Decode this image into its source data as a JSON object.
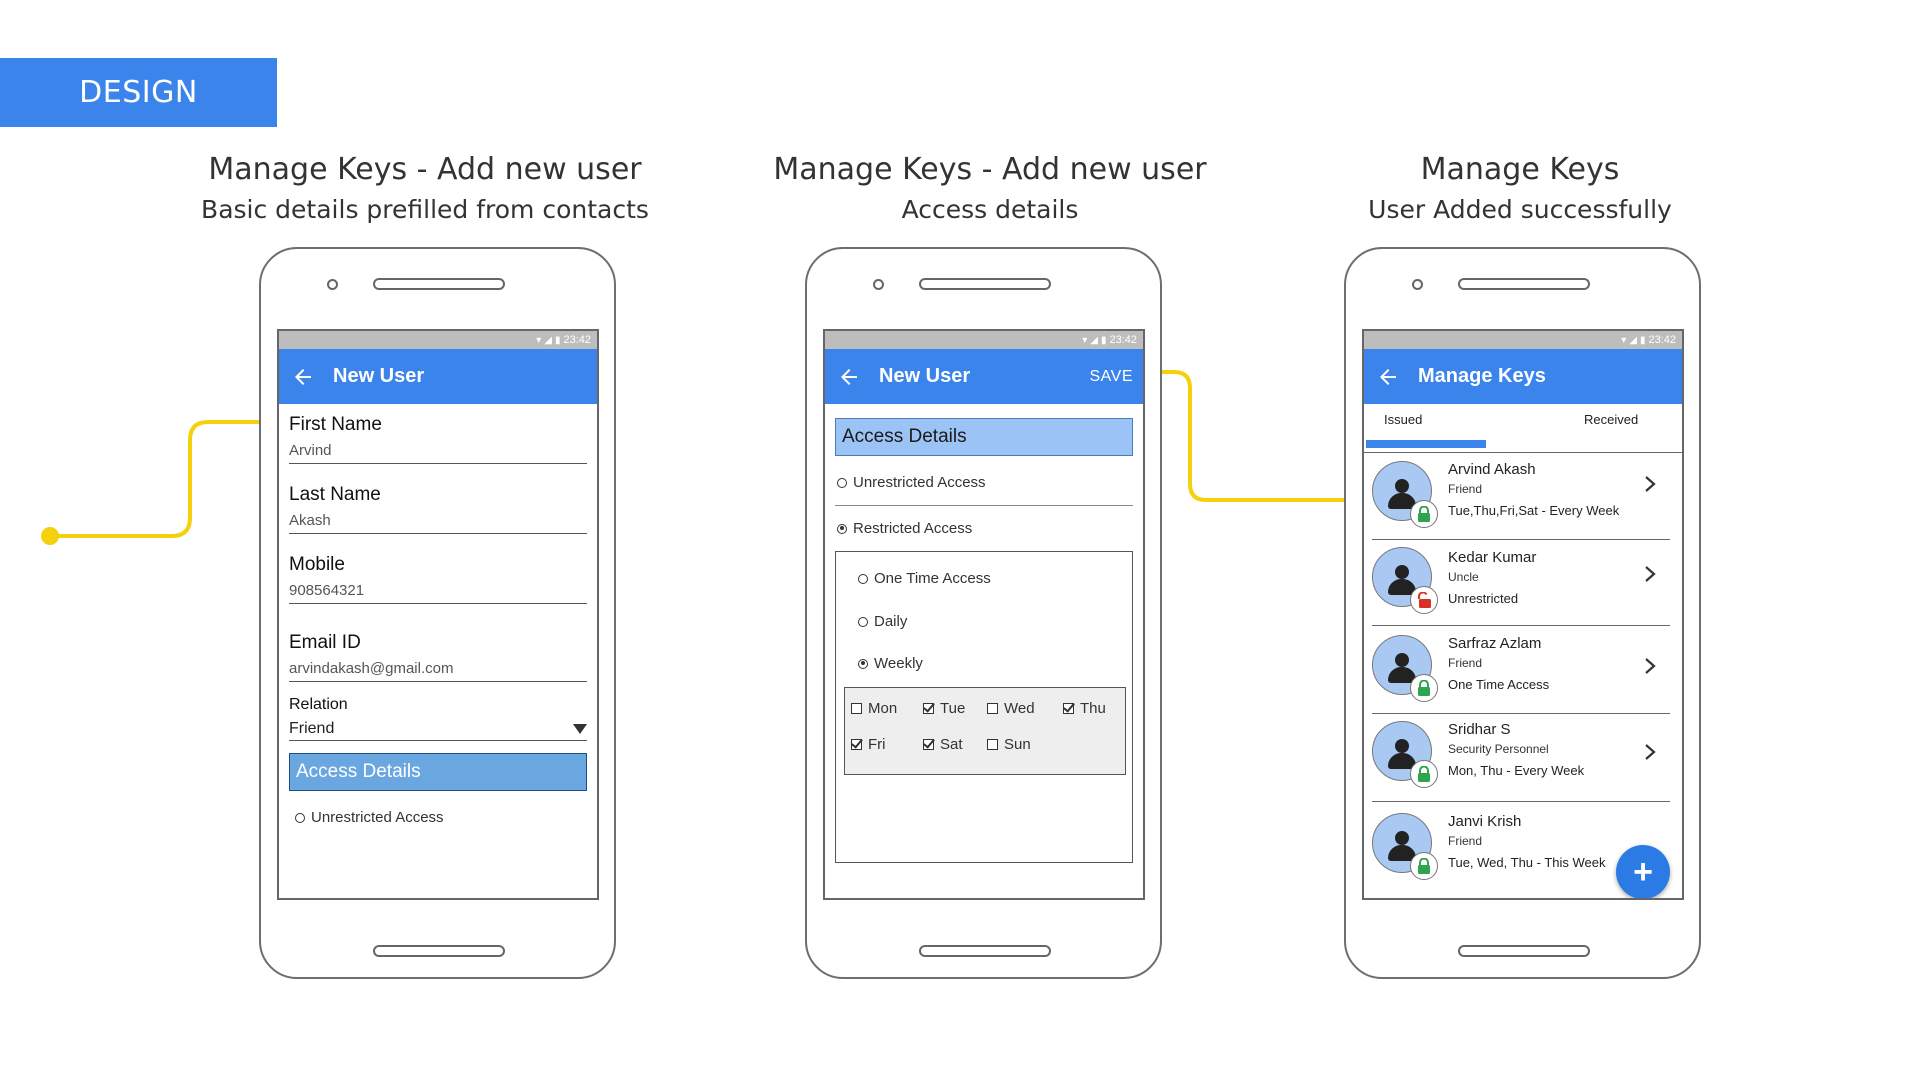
{
  "banner": {
    "label": "DESIGN"
  },
  "colors": {
    "accent": "#3b84ec",
    "connector": "#f5d10c",
    "lock_green": "#2ea44f",
    "lock_red": "#d93025"
  },
  "headings": [
    {
      "title": "Manage Keys - Add new user",
      "subtitle": "Basic details prefilled from contacts"
    },
    {
      "title": "Manage Keys - Add new user",
      "subtitle": "Access details"
    },
    {
      "title": "Manage Keys",
      "subtitle": "User Added successfully"
    }
  ],
  "status": {
    "time": "23:42"
  },
  "screen1": {
    "title": "New User",
    "fields": [
      {
        "label": "First Name",
        "value": "Arvind"
      },
      {
        "label": "Last Name",
        "value": "Akash"
      },
      {
        "label": "Mobile",
        "value": "908564321"
      },
      {
        "label": "Email ID",
        "value": "arvindakash@gmail.com"
      }
    ],
    "relation": {
      "label": "Relation",
      "value": "Friend"
    },
    "section": "Access Details",
    "option": "Unrestricted Access"
  },
  "screen2": {
    "title": "New User",
    "save": "SAVE",
    "section": "Access Details",
    "access_options": [
      "Unrestricted Access",
      "Restricted Access"
    ],
    "restricted_options": [
      "One Time Access",
      "Daily",
      "Weekly"
    ],
    "days": [
      {
        "label": "Mon",
        "checked": false
      },
      {
        "label": "Tue",
        "checked": true
      },
      {
        "label": "Wed",
        "checked": false
      },
      {
        "label": "Thu",
        "checked": true
      },
      {
        "label": "Fri",
        "checked": true
      },
      {
        "label": "Sat",
        "checked": true
      },
      {
        "label": "Sun",
        "checked": false
      }
    ]
  },
  "screen3": {
    "title": "Manage Keys",
    "tabs": [
      "Issued",
      "Received"
    ],
    "users": [
      {
        "name": "Arvind Akash",
        "relation": "Friend",
        "schedule": "Tue,Thu,Fri,Sat - Every Week",
        "lock": "locked"
      },
      {
        "name": "Kedar Kumar",
        "relation": "Uncle",
        "schedule": "Unrestricted",
        "lock": "unlocked"
      },
      {
        "name": "Sarfraz Azlam",
        "relation": "Friend",
        "schedule": "One Time Access",
        "lock": "locked"
      },
      {
        "name": "Sridhar S",
        "relation": "Security Personnel",
        "schedule": "Mon, Thu - Every Week",
        "lock": "locked"
      },
      {
        "name": "Janvi Krish",
        "relation": "Friend",
        "schedule": "Tue, Wed, Thu - This Week",
        "lock": "locked"
      }
    ],
    "fab": "+"
  }
}
